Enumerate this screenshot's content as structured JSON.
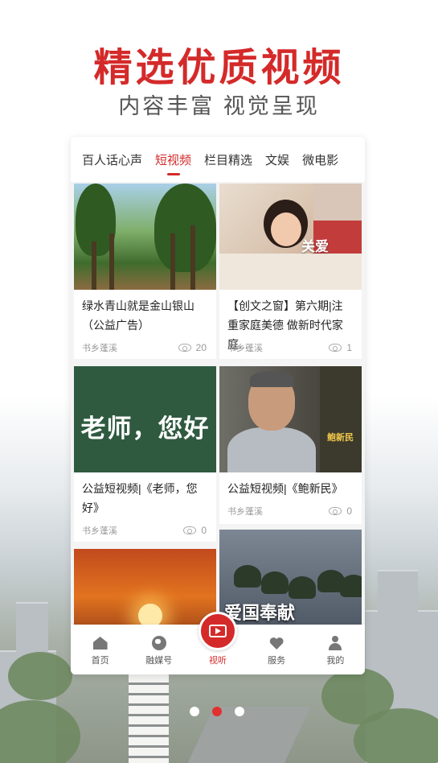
{
  "hero": {
    "title": "精选优质视频",
    "subtitle": "内容丰富 视觉呈现"
  },
  "tabs": [
    {
      "label": "百人话心声",
      "active": false
    },
    {
      "label": "短视频",
      "active": true
    },
    {
      "label": "栏目精选",
      "active": false
    },
    {
      "label": "文娱",
      "active": false
    },
    {
      "label": "微电影",
      "active": false
    }
  ],
  "cards": [
    {
      "title": "绿水青山就是金山银山（公益广告）",
      "source": "书乡蓬溪",
      "views": "20"
    },
    {
      "title": "【创文之窗】第六期|注重家庭美德 做新时代家庭...",
      "source": "书乡蓬溪",
      "views": "1",
      "thumb_caption": "关爱"
    },
    {
      "title": "公益短视频|《老师，您好》",
      "source": "书乡蓬溪",
      "views": "0",
      "thumb_caption": "老师，您好"
    },
    {
      "title": "公益短视频|《鲍新民》",
      "source": "书乡蓬溪",
      "views": "0",
      "thumb_caption": "鲍新民"
    },
    {
      "title": "",
      "source": "",
      "views": ""
    },
    {
      "title": "",
      "source": "",
      "views": "",
      "thumb_caption": "爱国奉献"
    }
  ],
  "bottom_nav": [
    {
      "label": "首页",
      "icon": "home-icon"
    },
    {
      "label": "融媒号",
      "icon": "globe-icon"
    },
    {
      "label": "视听",
      "icon": "video-play-icon",
      "active": true
    },
    {
      "label": "服务",
      "icon": "heart-icon"
    },
    {
      "label": "我的",
      "icon": "user-icon"
    }
  ],
  "carousel": {
    "count": 3,
    "active_index": 1
  },
  "colors": {
    "accent": "#d42a2a",
    "muted": "#999999"
  }
}
